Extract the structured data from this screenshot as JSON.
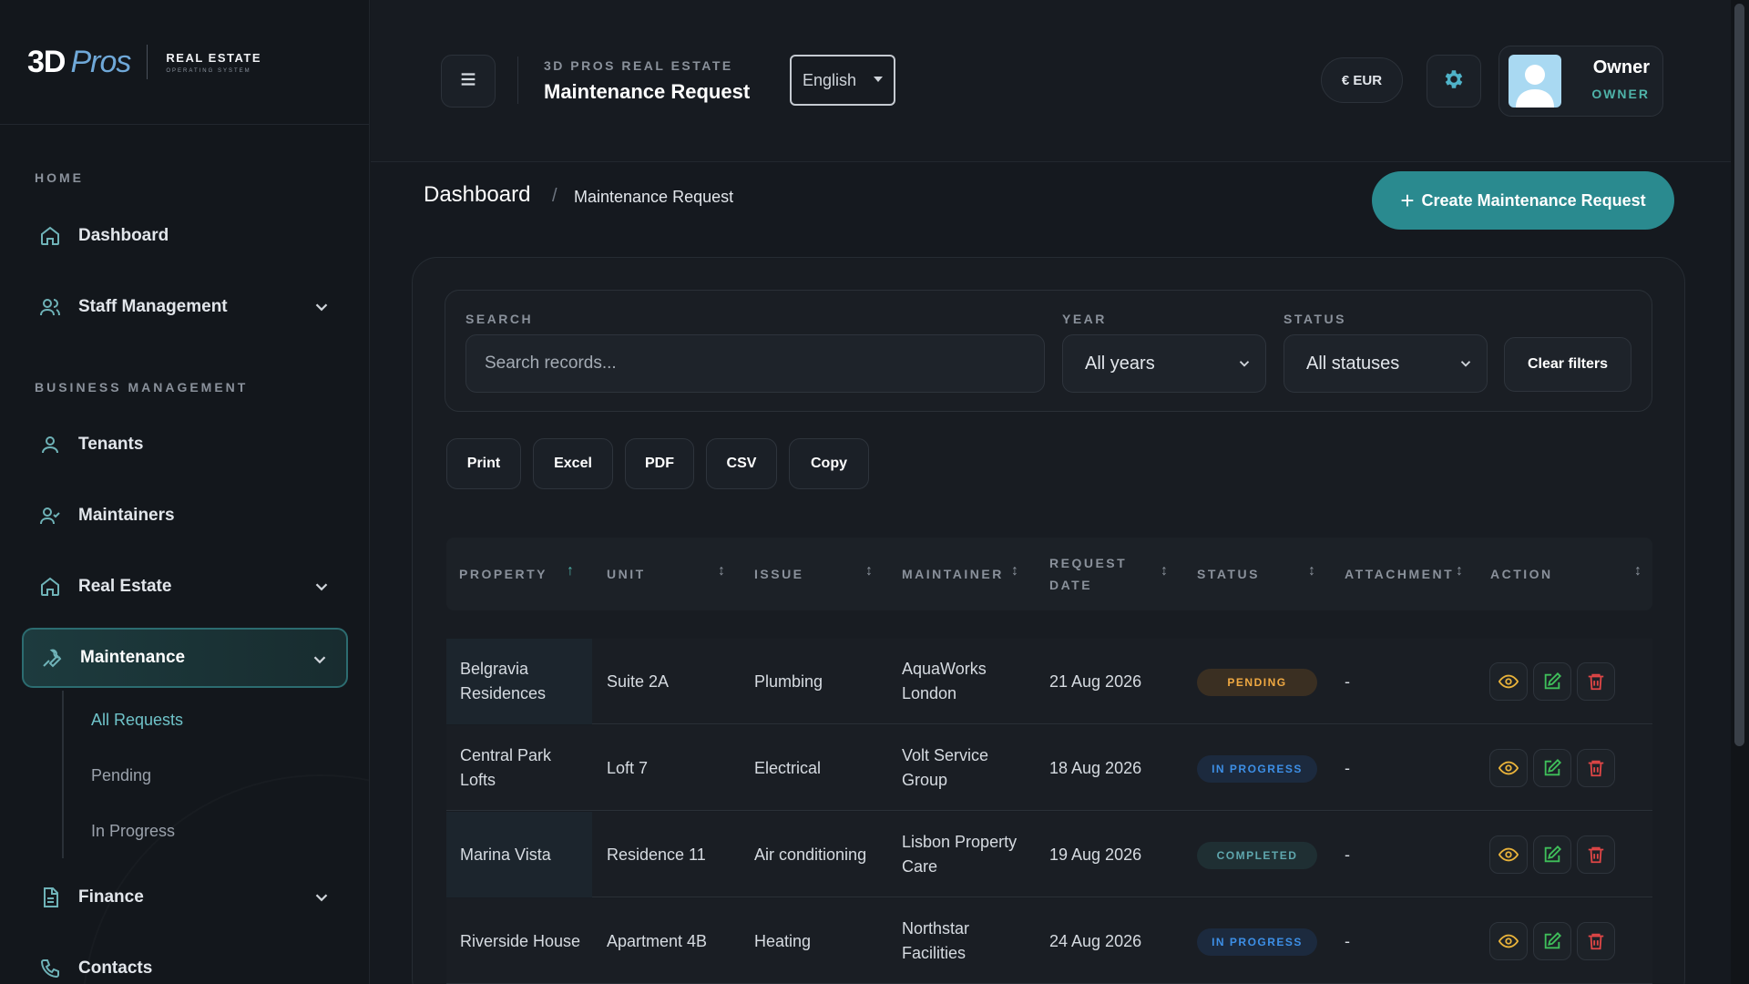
{
  "brand": {
    "logo_3d": "3D",
    "logo_pros": "Pros",
    "tag_top": "REAL ESTATE",
    "tag_bottom": "OPERATING SYSTEM"
  },
  "sidebar": {
    "sections": [
      {
        "label": "HOME"
      },
      {
        "label": "BUSINESS MANAGEMENT"
      }
    ],
    "items": [
      {
        "label": "Dashboard",
        "icon": "home-icon"
      },
      {
        "label": "Staff Management",
        "icon": "users-icon"
      },
      {
        "label": "Tenants",
        "icon": "user-icon"
      },
      {
        "label": "Maintainers",
        "icon": "user-check-icon"
      },
      {
        "label": "Real Estate",
        "icon": "home-icon"
      },
      {
        "label": "Maintenance",
        "icon": "wrench-icon"
      },
      {
        "label": "Finance",
        "icon": "document-icon"
      },
      {
        "label": "Contacts",
        "icon": "phone-icon"
      }
    ],
    "subitems": [
      {
        "label": "All Requests"
      },
      {
        "label": "Pending"
      },
      {
        "label": "In Progress"
      }
    ]
  },
  "header": {
    "supertitle": "3D PROS REAL ESTATE",
    "title": "Maintenance Request",
    "language": "English",
    "currency": "€ EUR",
    "user_name": "Owner",
    "user_role": "OWNER"
  },
  "breadcrumb": {
    "root": "Dashboard",
    "separator": "/",
    "current": "Maintenance Request"
  },
  "create_button": "Create Maintenance Request",
  "filters": {
    "search_label": "SEARCH",
    "search_placeholder": "Search records...",
    "year_label": "YEAR",
    "year_value": "All years",
    "status_label": "STATUS",
    "status_value": "All statuses",
    "clear_label": "Clear filters"
  },
  "export_buttons": [
    "Print",
    "Excel",
    "PDF",
    "CSV",
    "Copy"
  ],
  "table": {
    "columns": [
      "PROPERTY",
      "UNIT",
      "ISSUE",
      "MAINTAINER",
      "REQUEST DATE",
      "STATUS",
      "ATTACHMENT",
      "ACTION"
    ],
    "rows": [
      {
        "property": "Belgravia Residences",
        "unit": "Suite 2A",
        "issue": "Plumbing",
        "maintainer": "AquaWorks London",
        "date": "21 Aug 2026",
        "status": "PENDING",
        "status_kind": "pending",
        "attachment": "-"
      },
      {
        "property": "Central Park Lofts",
        "unit": "Loft 7",
        "issue": "Electrical",
        "maintainer": "Volt Service Group",
        "date": "18 Aug 2026",
        "status": "IN PROGRESS",
        "status_kind": "inprogress",
        "attachment": "-"
      },
      {
        "property": "Marina Vista",
        "unit": "Residence 11",
        "issue": "Air conditioning",
        "maintainer": "Lisbon Property Care",
        "date": "19 Aug 2026",
        "status": "COMPLETED",
        "status_kind": "completed",
        "attachment": "-"
      },
      {
        "property": "Riverside House",
        "unit": "Apartment 4B",
        "issue": "Heating",
        "maintainer": "Northstar Facilities",
        "date": "24 Aug 2026",
        "status": "IN PROGRESS",
        "status_kind": "inprogress",
        "attachment": "-"
      }
    ]
  },
  "colors": {
    "accent": "#2a8a8f",
    "pending": "#f0a942",
    "in_progress": "#3d8fe6",
    "completed": "#5fa7ae",
    "view": "#e8b23a",
    "edit": "#3fbf5a",
    "delete": "#e04646"
  }
}
